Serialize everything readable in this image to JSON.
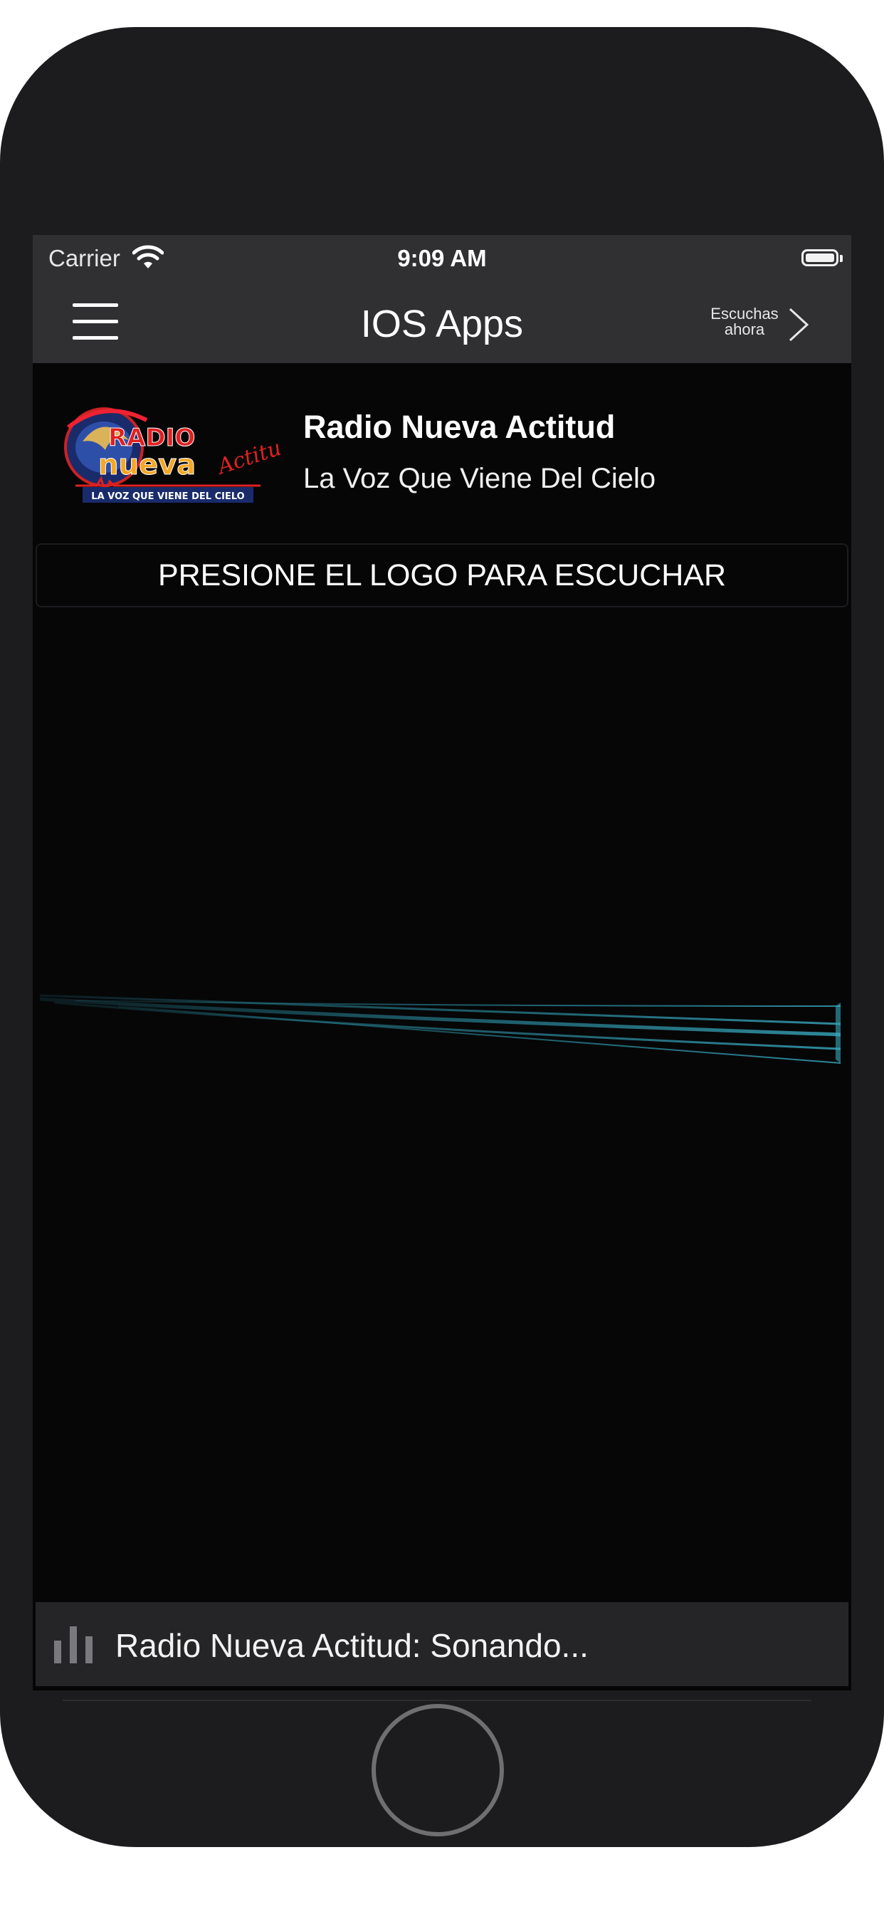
{
  "status_bar": {
    "carrier": "Carrier",
    "time": "9:09 AM",
    "wifi_icon": "wifi-icon",
    "battery_icon": "battery-icon"
  },
  "nav_bar": {
    "title": "IOS Apps",
    "menu_icon": "hamburger-menu-icon",
    "listen_now_line1": "Escuchas",
    "listen_now_line2": "ahora",
    "listen_now_icon": "chevron-right-icon"
  },
  "station": {
    "name": "Radio Nueva Actitud",
    "slogan": "La Voz Que Viene Del Cielo",
    "logo": {
      "text_radio": "RADIO",
      "text_nueva": "nueva",
      "text_actitud": "Actitud",
      "tagline": "LA VOZ QUE VIENE DEL CIELO"
    }
  },
  "banner": {
    "text": "PRESIONE EL LOGO PARA ESCUCHAR"
  },
  "player": {
    "now_playing": "Radio Nueva Actitud: Sonando...",
    "icon": "equalizer-bars-icon"
  },
  "colors": {
    "background": "#060607",
    "bar": "#303033",
    "accent_wave": "#2a8ca0"
  }
}
